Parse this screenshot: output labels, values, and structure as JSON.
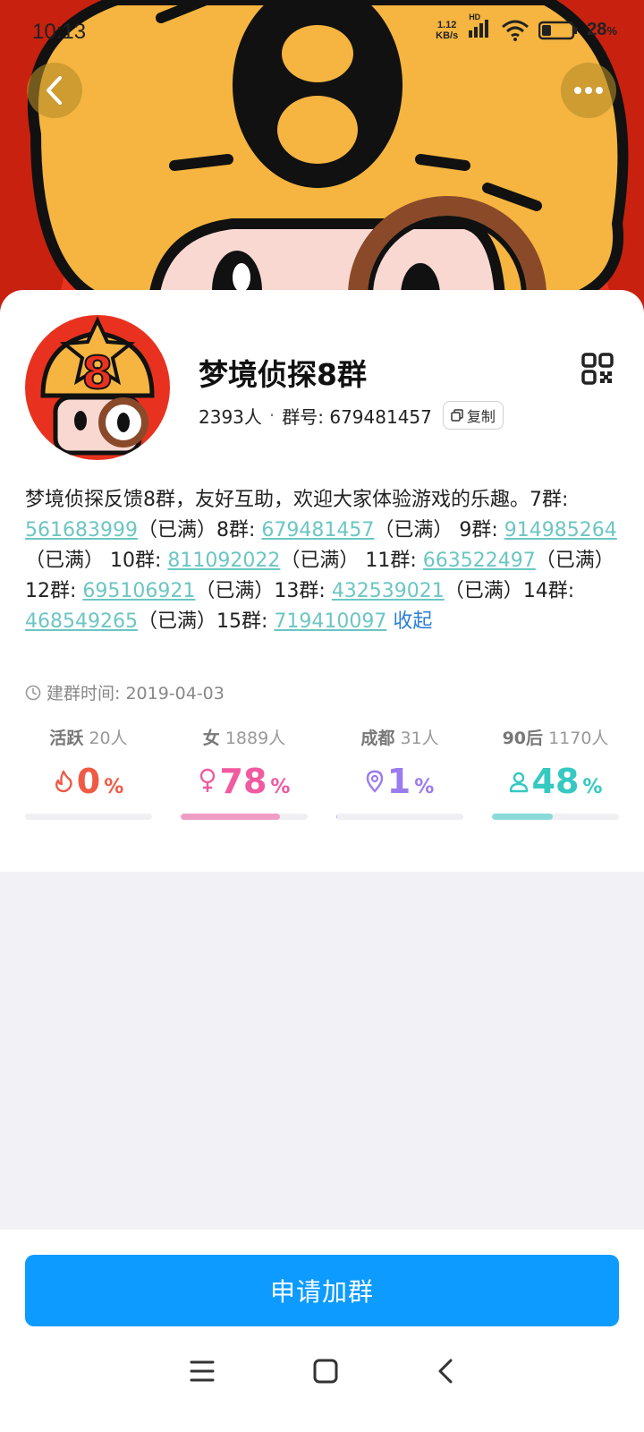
{
  "status_bar": {
    "time": "10:13",
    "net_speed_value": "1.12",
    "net_speed_unit": "KB/s",
    "net_type": "HD",
    "battery": "28",
    "battery_unit": "%"
  },
  "group": {
    "name": "梦境侦探8群",
    "members": "2393人",
    "id_label": "群号: 679481457",
    "copy_label": "复制",
    "description": {
      "intro": "梦境侦探反馈8群，友好互助，欢迎大家体验游戏的乐趣。",
      "entries": [
        {
          "label": "7群: ",
          "number": "561683999",
          "status": "（已满）"
        },
        {
          "label": "8群: ",
          "number": "679481457",
          "status": "（已满） "
        },
        {
          "label": "9群: ",
          "number": "914985264",
          "status": "（已满） "
        },
        {
          "label": "10群: ",
          "number": "811092022",
          "status": "（已满） "
        },
        {
          "label": "11群: ",
          "number": "663522497",
          "status": "（已满） "
        },
        {
          "label": "12群: ",
          "number": "695106921",
          "status": "（已满）"
        },
        {
          "label": "13群: ",
          "number": "432539021",
          "status": "（已满）"
        },
        {
          "label": "14群: ",
          "number": "468549265",
          "status": "（已满）"
        },
        {
          "label": "15群: ",
          "number": "719410097",
          "status": " "
        }
      ],
      "collapse_label": "收起"
    },
    "created": "建群时间: 2019-04-03"
  },
  "stats": [
    {
      "label": "活跃",
      "sub": "20人",
      "value": "0",
      "unit": "%",
      "percent": 0,
      "color": "#f05a45",
      "icon": "flame-icon"
    },
    {
      "label": "女",
      "sub": "1889人",
      "value": "78",
      "unit": "%",
      "percent": 78,
      "color": "#f05aa0",
      "icon": "female-icon"
    },
    {
      "label": "成都",
      "sub": "31人",
      "value": "1",
      "unit": "%",
      "percent": 1,
      "color": "#9a7cf0",
      "icon": "location-pin-icon"
    },
    {
      "label": "90后",
      "sub": "1170人",
      "value": "48",
      "unit": "%",
      "percent": 48,
      "color": "#35c9c2",
      "icon": "person-icon"
    }
  ],
  "join_button": "申请加群"
}
